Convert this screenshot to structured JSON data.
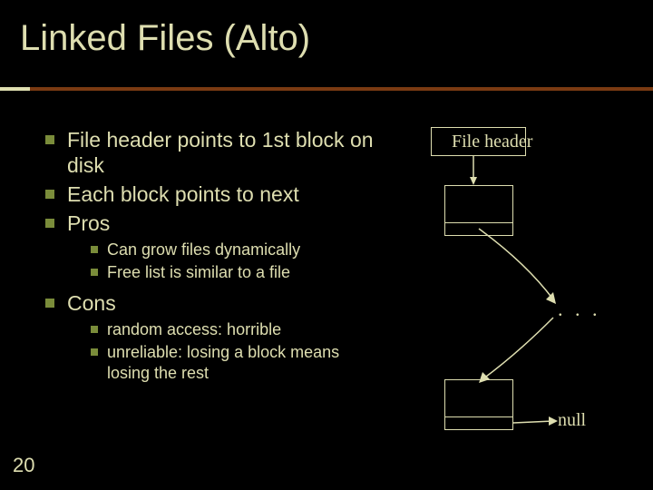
{
  "title": "Linked Files (Alto)",
  "bullets": {
    "b1": "File header points to 1st block on disk",
    "b2": "Each block points to next",
    "b3": "Pros",
    "b3a": "Can grow files dynamically",
    "b3b": "Free list is similar to a file",
    "b4": "Cons",
    "b4a": "random access: horrible",
    "b4b": "unreliable: losing a block means losing the rest"
  },
  "diagram": {
    "header": "File header",
    "dots": ". . .",
    "null": "null"
  },
  "page_number": "20"
}
